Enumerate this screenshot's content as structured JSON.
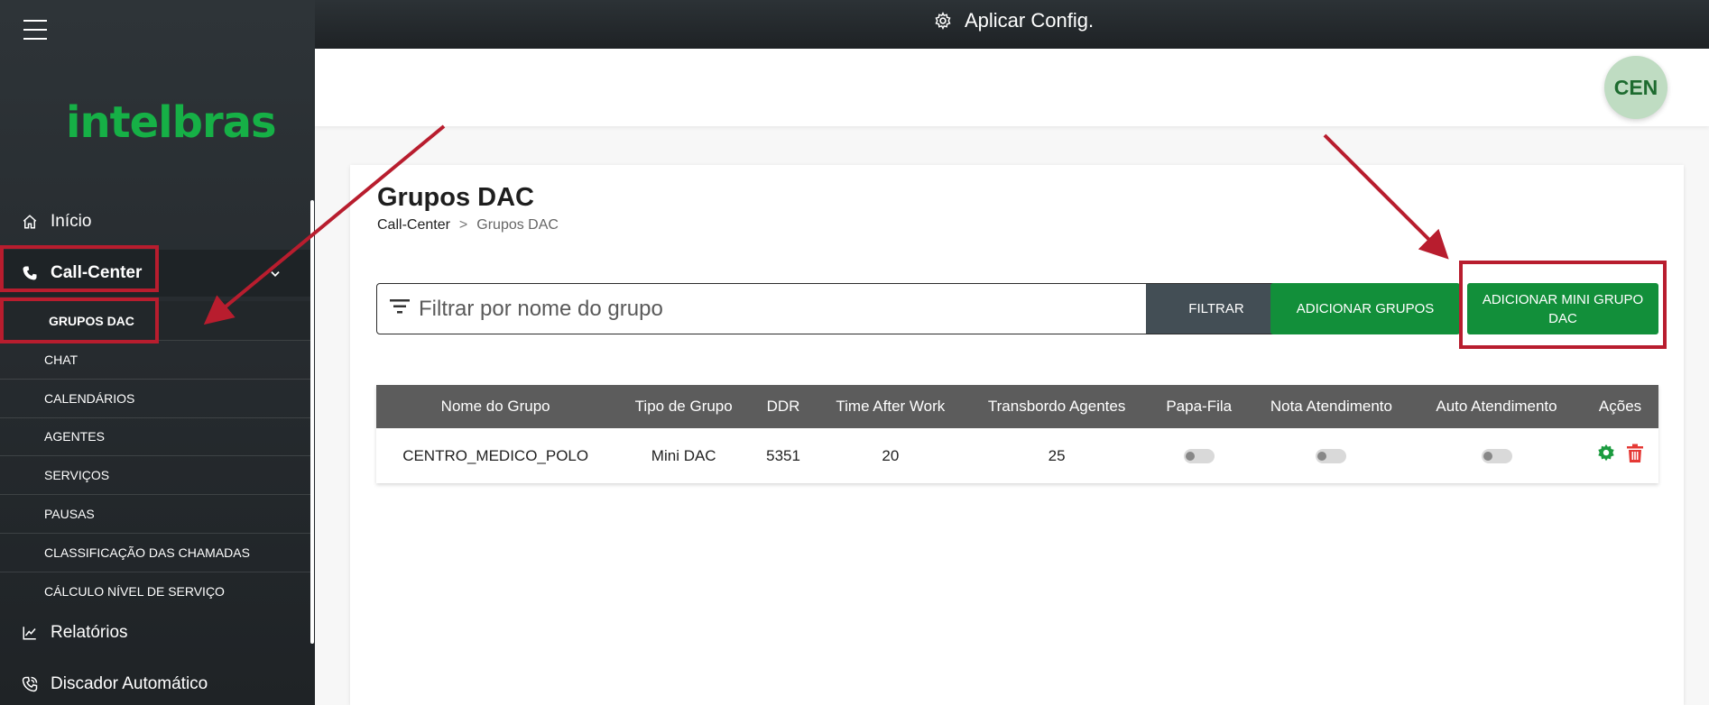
{
  "sidebar": {
    "logo": "intelbras",
    "items": [
      {
        "label": "Início",
        "icon": "home-icon"
      },
      {
        "label": "Call-Center",
        "icon": "phone-icon"
      },
      {
        "label": "Relatórios",
        "icon": "chart-icon"
      },
      {
        "label": "Discador Automático",
        "icon": "phone-dial-icon"
      }
    ],
    "subitems": [
      {
        "label": "GRUPOS DAC"
      },
      {
        "label": "CHAT"
      },
      {
        "label": "CALENDÁRIOS"
      },
      {
        "label": "AGENTES"
      },
      {
        "label": "SERVIÇOS"
      },
      {
        "label": "PAUSAS"
      },
      {
        "label": "CLASSIFICAÇÃO DAS CHAMADAS"
      },
      {
        "label": "CÁLCULO NÍVEL DE SERVIÇO"
      }
    ]
  },
  "topbar": {
    "apply_label": "Aplicar Config."
  },
  "user": {
    "initials": "CEN"
  },
  "page": {
    "title": "Grupos DAC",
    "breadcrumb": {
      "parent": "Call-Center",
      "separator": ">",
      "current": "Grupos DAC"
    }
  },
  "filter": {
    "placeholder": "Filtrar por nome do grupo",
    "button": "FILTRAR"
  },
  "actions": {
    "add_groups": "ADICIONAR GRUPOS",
    "add_mini": "ADICIONAR MINI GRUPO DAC"
  },
  "table": {
    "headers": [
      "Nome do Grupo",
      "Tipo de Grupo",
      "DDR",
      "Time After Work",
      "Transbordo Agentes",
      "Papa-Fila",
      "Nota Atendimento",
      "Auto Atendimento",
      "Ações"
    ],
    "rows": [
      {
        "name": "CENTRO_MEDICO_POLO",
        "type": "Mini DAC",
        "ddr": "5351",
        "taw": "20",
        "transbordo": "25",
        "papa_fila": false,
        "nota": false,
        "auto": false
      }
    ]
  },
  "colors": {
    "brand": "#16b046",
    "button_green": "#128f3a",
    "annotation_red": "#b81d2e",
    "delete_red": "#e53935"
  }
}
